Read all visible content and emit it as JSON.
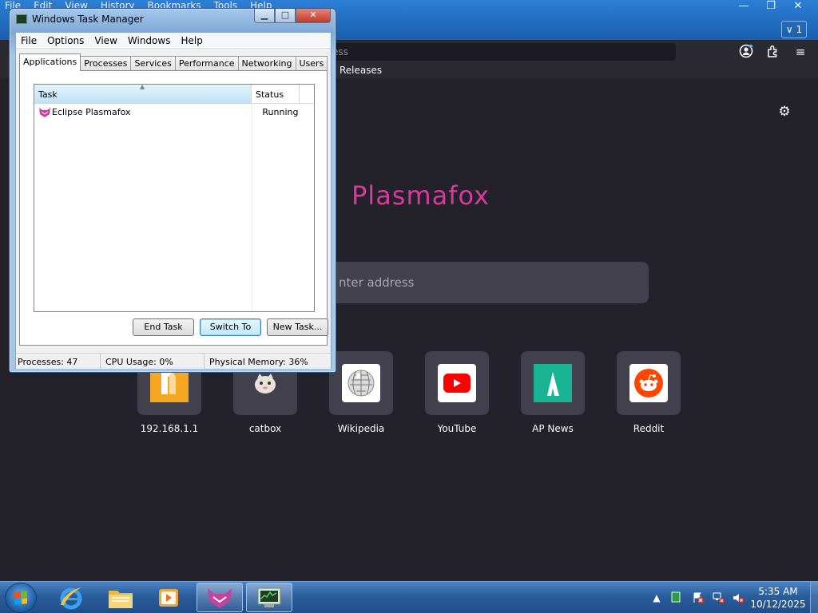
{
  "browser": {
    "menu": [
      "File",
      "Edit",
      "View",
      "History",
      "Bookmarks",
      "Tools",
      "Help"
    ],
    "window_controls": {
      "minimize": "—",
      "maximize": "❐",
      "close": "✕"
    },
    "tab_count": "1",
    "url_placeholder_fragment": "ess",
    "bookmark": "Releases",
    "brand": "Plasmafox",
    "search_placeholder": "nter address",
    "shortcuts": [
      {
        "label": "192.168.1.1",
        "icon": "router-icon",
        "color": "#f5a623"
      },
      {
        "label": "catbox",
        "icon": "catbox-icon",
        "color": "#42414d"
      },
      {
        "label": "Wikipedia",
        "icon": "wikipedia-icon",
        "color": "#ffffff"
      },
      {
        "label": "YouTube",
        "icon": "youtube-icon",
        "color": "#ff0000"
      },
      {
        "label": "AP News",
        "icon": "apnews-icon",
        "color": "#1ab394"
      },
      {
        "label": "Reddit",
        "icon": "reddit-icon",
        "color": "#ff4500"
      }
    ],
    "accent": "#d63a9b"
  },
  "taskmanager": {
    "title": "Windows Task Manager",
    "menu": [
      "File",
      "Options",
      "View",
      "Windows",
      "Help"
    ],
    "tabs": [
      "Applications",
      "Processes",
      "Services",
      "Performance",
      "Networking",
      "Users"
    ],
    "active_tab": "Applications",
    "columns": {
      "task": "Task",
      "status": "Status"
    },
    "rows": [
      {
        "task": "Eclipse Plasmafox",
        "status": "Running"
      }
    ],
    "buttons": {
      "end_task": "End Task",
      "switch_to": "Switch To",
      "new_task": "New Task..."
    },
    "status": {
      "processes": "Processes: 47",
      "cpu": "CPU Usage: 0%",
      "memory": "Physical Memory: 36%"
    }
  },
  "taskbar": {
    "time": "5:35 AM",
    "date": "10/12/2025",
    "apps": [
      "start-button",
      "internet-explorer",
      "file-explorer",
      "media-player",
      "plasmafox",
      "task-manager"
    ]
  }
}
